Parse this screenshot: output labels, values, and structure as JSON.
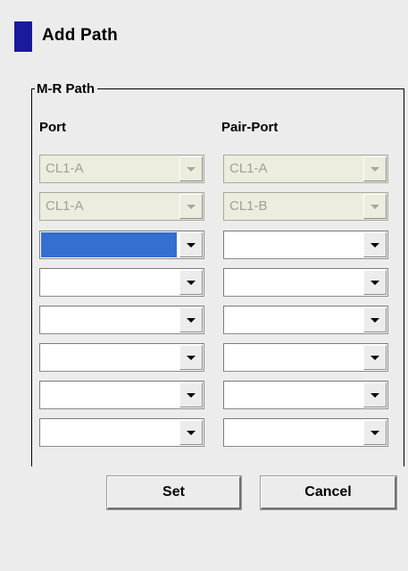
{
  "dialog": {
    "title": "Add Path"
  },
  "group": {
    "label": "M-R Path",
    "port_header": "Port",
    "pair_port_header": "Pair-Port"
  },
  "rows": [
    {
      "port": "CL1-A",
      "pair_port": "CL1-A",
      "enabled": false
    },
    {
      "port": "CL1-A",
      "pair_port": "CL1-B",
      "enabled": false
    },
    {
      "port": "",
      "pair_port": "",
      "enabled": true,
      "port_focused": true
    },
    {
      "port": "",
      "pair_port": "",
      "enabled": true
    },
    {
      "port": "",
      "pair_port": "",
      "enabled": true
    },
    {
      "port": "",
      "pair_port": "",
      "enabled": true
    },
    {
      "port": "",
      "pair_port": "",
      "enabled": true
    },
    {
      "port": "",
      "pair_port": "",
      "enabled": true
    }
  ],
  "buttons": {
    "set_label": "Set",
    "cancel_label": "Cancel"
  },
  "colors": {
    "title_marker": "#1a1a9c",
    "selection": "#356fcf",
    "background": "#ececec"
  }
}
